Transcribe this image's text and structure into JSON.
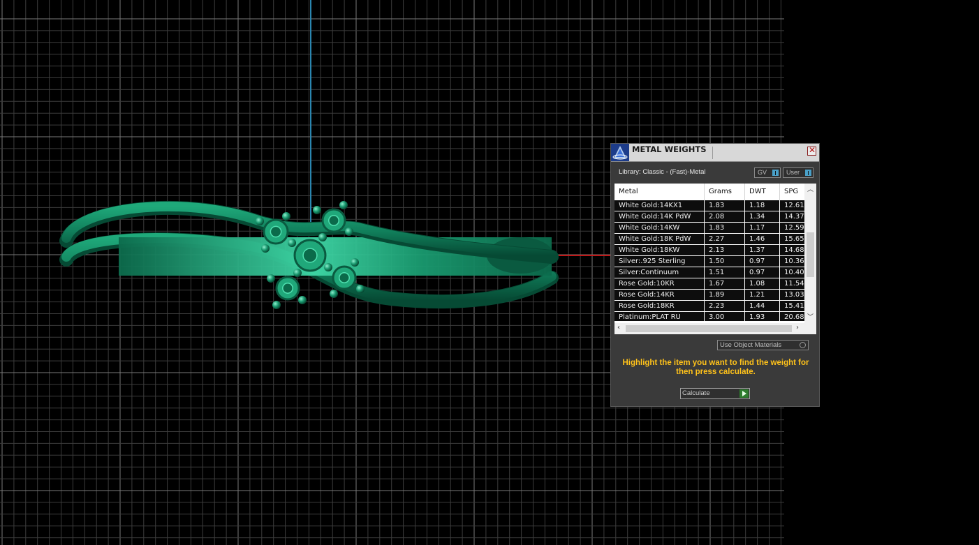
{
  "panel": {
    "title": "METAL WEIGHTS",
    "library": "Library: Classic - (Fast)-Metal",
    "gv_label": "GV",
    "user_label": "User",
    "use_object_materials": "Use Object Materials",
    "instruction": "Highlight the item you want to find the weight for then press calculate.",
    "calculate": "Calculate"
  },
  "table": {
    "columns": [
      "Metal",
      "Grams",
      "DWT",
      "SPG"
    ],
    "rows": [
      [
        "White Gold:14KX1",
        "1.83",
        "1.18",
        "12.61"
      ],
      [
        "White Gold:14K PdW",
        "2.08",
        "1.34",
        "14.37"
      ],
      [
        "White Gold:14KW",
        "1.83",
        "1.17",
        "12.59"
      ],
      [
        "White Gold:18K PdW",
        "2.27",
        "1.46",
        "15.65"
      ],
      [
        "White Gold:18KW",
        "2.13",
        "1.37",
        "14.68"
      ],
      [
        "Silver:.925 Sterling",
        "1.50",
        "0.97",
        "10.36"
      ],
      [
        "Silver:Continuum",
        "1.51",
        "0.97",
        "10.40"
      ],
      [
        "Rose Gold:10KR",
        "1.67",
        "1.08",
        "11.54"
      ],
      [
        "Rose Gold:14KR",
        "1.89",
        "1.21",
        "13.03"
      ],
      [
        "Rose Gold:18KR",
        "2.23",
        "1.44",
        "15.41"
      ],
      [
        "Platinum:PLAT RU",
        "3.00",
        "1.93",
        "20.68"
      ]
    ]
  },
  "viewport": {
    "object": "ring model",
    "colors": {
      "background": "#000000",
      "grid": "#5a5a5a",
      "y_axis": "#2a86b0",
      "x_axis": "#c01818",
      "ring": "#127a5a"
    }
  }
}
